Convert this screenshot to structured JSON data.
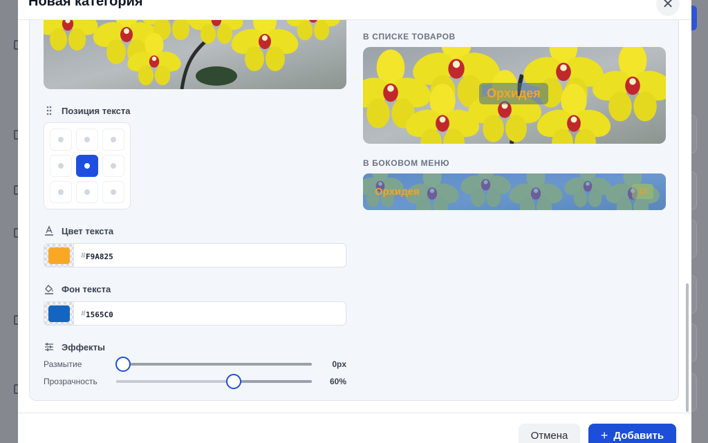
{
  "dialog": {
    "title": "Новая категория",
    "close_icon": "close-icon"
  },
  "position": {
    "title": "Позиция текста",
    "icon": "drag-handle-icon",
    "selected": "middle-center"
  },
  "text_color": {
    "title": "Цвет текста",
    "icon": "text-color-icon",
    "hash": "#",
    "value": "F9A825",
    "swatch": "#F9A825"
  },
  "text_background": {
    "title": "Фон текста",
    "icon": "fill-color-icon",
    "hash": "#",
    "value": "1565C0",
    "swatch": "#1565C0"
  },
  "effects": {
    "title": "Эффекты",
    "icon": "sliders-icon",
    "blur": {
      "label": "Размытие",
      "value": "0px",
      "level": 0
    },
    "opacity": {
      "label": "Прозрачность",
      "value": "60%",
      "level": 0.6
    }
  },
  "preview": {
    "product_list_label": "В СПИСКЕ ТОВАРОВ",
    "sidebar_label": "В БОКОВОМ МЕНЮ",
    "category_name": "Орхидея",
    "item_count": "12"
  },
  "footer": {
    "cancel_label": "Отмена",
    "add_label": "Добавить",
    "add_icon": "plus-icon"
  },
  "colors": {
    "accent": "#1d4ed8",
    "text_color": "#F9A825",
    "text_background": "#1565C0"
  }
}
